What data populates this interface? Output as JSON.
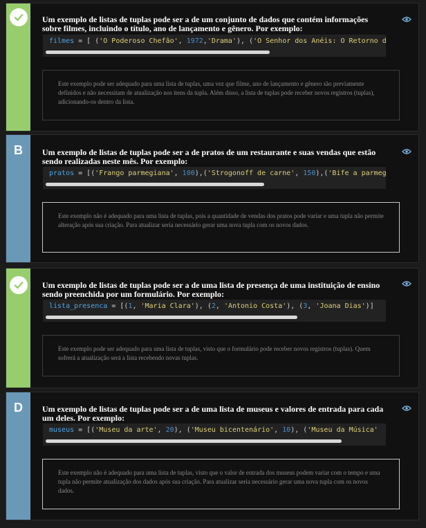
{
  "options": [
    {
      "marker": "check",
      "question": "Um exemplo de listas de tuplas pode ser a de um conjunto de dados que contém informações sobre filmes, incluindo o título, ano de lançamento e gênero. Por exemplo:",
      "code": {
        "var": "filmes",
        "a": " = [ (",
        "b": "'O Poderoso Chefão'",
        "c": ", ",
        "d": "1972",
        "e": ",",
        "f": "'Drama'",
        "g": "), (",
        "h": "'O Senhor dos Anéis: O Retorno do Rei'"
      },
      "explanation": "Este exemplo pode ser adequado para uma lista de tuplas, uma vez que filme, ano de lançamento e gênero são previamente definidos e não necessitam de atualização nos itens da tupla. Além disso, a lista de tuplas pode receber novos registros (tuplas), adicionando-os dentro da lista."
    },
    {
      "marker": "B",
      "question": "Um exemplo de listas de tuplas pode ser a de pratos de um restaurante e suas vendas que estão sendo realizadas neste mês. Por exemplo:",
      "code": {
        "var": "pratos",
        "a": " = [(",
        "b": "'Frango parmegiana'",
        "c": ", ",
        "d": "100",
        "e": "),(",
        "f": "'Strogonoff de carne'",
        "g": ", ",
        "h": "150",
        "i": "),(",
        "j": "'Bife a parmegiana'"
      },
      "explanation": "Este exemplo não é adequado para uma lista de tuplas, pois a quantidade de vendas dos pratos pode variar e uma tupla não permite alteração após sua criação. Para atualizar seria necessário gerar uma nova tupla com os novos dados."
    },
    {
      "marker": "check",
      "question": "Um exemplo de listas de tuplas pode ser a de uma lista de presença de uma instituição de ensino sendo preenchida por um formulário. Por exemplo:",
      "code": {
        "var": "lista_presenca",
        "a": " = [(",
        "b": "1",
        "c": ", ",
        "d": "'Maria Clara'",
        "e": "), (",
        "f": "2",
        "g": ", ",
        "h": "'Antonio Costa'",
        "i": "), (",
        "j": "3",
        "k": ", ",
        "l": "'Joana Dias'",
        "m": ")]"
      },
      "explanation": "Este exemplo pode ser adequado para uma lista de tuplas, visto que o formulário pode receber novos registros (tuplas). Quem sofrerá a atualização será a lista recebendo novas tuplas."
    },
    {
      "marker": "D",
      "question": "Um exemplo de listas de tuplas pode ser a de uma lista de museus e valores de entrada para cada um deles. Por exemplo:",
      "code": {
        "var": "museus",
        "a": " = [(",
        "b": "'Museu da arte'",
        "c": ", ",
        "d": "20",
        "e": "), (",
        "f": "'Museu bicentenário'",
        "g": ", ",
        "h": "10",
        "i": "), (",
        "j": "'Museu da Música'"
      },
      "explanation": "Este exemplo não é adequado para uma lista de tuplas, visto que o valor de entrada dos museus podem variar com o tempo e uma tupla não permite atualização dos dados após sua criação. Para atualizar seria necessário gerar uma nova tupla com os novos dados."
    }
  ],
  "colors": {
    "correct": "#98cd6e",
    "neutral": "#6a99b8",
    "icon": "#7ab3e0"
  },
  "icons": {
    "correct": "check-icon",
    "toggle": "eye-icon"
  }
}
